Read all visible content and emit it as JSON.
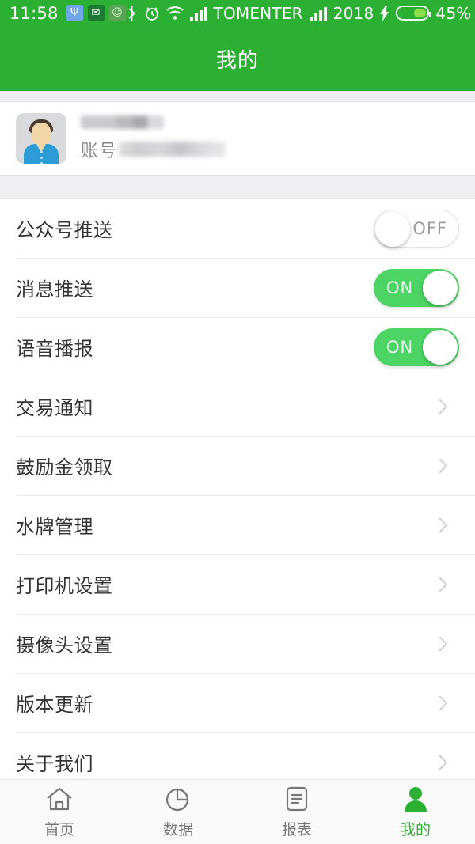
{
  "statusbar": {
    "time": "11:58",
    "usb_icon": "usb-icon",
    "mail_icon": "mail-icon",
    "android_icon": "android-icon",
    "bluetooth_icon": "bluetooth-icon",
    "alarm_icon": "alarm-icon",
    "wifi_icon": "wifi-icon",
    "signal1_icon": "signal-bars-icon",
    "carrier": "TOMENTER",
    "signal2_icon": "signal-bars-icon",
    "clock_number": "2018",
    "charging_icon": "charging-bolt-icon",
    "battery_percent": "45%",
    "battery_level": 45
  },
  "header": {
    "title": "我的"
  },
  "profile": {
    "avatar_icon": "default-user-avatar",
    "name_redacted": "",
    "account_label": "账号",
    "account_redacted": ""
  },
  "settings": {
    "toggle_rows": [
      {
        "label": "公众号推送",
        "state": "OFF",
        "on": false
      },
      {
        "label": "消息推送",
        "state": "ON",
        "on": true
      },
      {
        "label": "语音播报",
        "state": "ON",
        "on": true
      }
    ],
    "link_rows": [
      {
        "label": "交易通知",
        "chevron": "chevron-right-icon"
      },
      {
        "label": "鼓励金领取",
        "chevron": "chevron-right-icon"
      },
      {
        "label": "水牌管理",
        "chevron": "chevron-right-icon"
      },
      {
        "label": "打印机设置",
        "chevron": "chevron-right-icon"
      },
      {
        "label": "摄像头设置",
        "chevron": "chevron-right-icon"
      },
      {
        "label": "版本更新",
        "chevron": "chevron-right-icon"
      },
      {
        "label": "关于我们",
        "chevron": "chevron-right-icon"
      }
    ]
  },
  "tabbar": {
    "items": [
      {
        "label": "首页",
        "icon": "home-icon",
        "active": false
      },
      {
        "label": "数据",
        "icon": "pie-chart-icon",
        "active": false
      },
      {
        "label": "报表",
        "icon": "document-icon",
        "active": false
      },
      {
        "label": "我的",
        "icon": "person-icon",
        "active": true
      }
    ]
  },
  "colors": {
    "brand_green": "#2CB034",
    "toggle_on_green": "#4CD464",
    "gap_grey": "#EEEFF3",
    "label_dark": "#333333",
    "muted_grey": "#888888"
  }
}
